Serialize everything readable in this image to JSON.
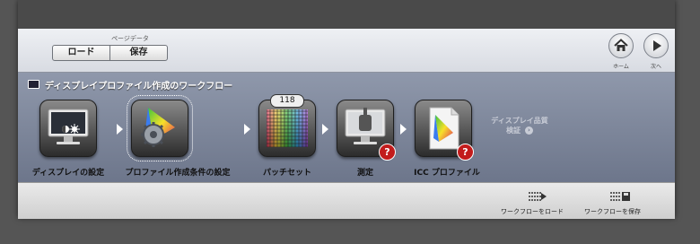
{
  "toolbar": {
    "page_data_label": "ページデータ",
    "load_label": "ロード",
    "save_label": "保存",
    "home_label": "ホーム",
    "next_label": "次へ"
  },
  "workflow": {
    "title": "ディスプレイプロファイル作成のワークフロー",
    "steps": [
      {
        "label": "ディスプレイの設定",
        "icon": "display-settings-icon"
      },
      {
        "label": "プロファイル作成条件の設定",
        "icon": "profile-conditions-icon"
      },
      {
        "label": "パッチセット",
        "icon": "patch-set-icon",
        "badge": "118"
      },
      {
        "label": "測定",
        "icon": "measurement-icon"
      },
      {
        "label": "ICC プロファイル",
        "icon": "icc-profile-icon"
      }
    ],
    "verify_label_1": "ディスプレイ品質",
    "verify_label_2": "検証"
  },
  "footer": {
    "load_workflow": "ワークフローをロード",
    "save_workflow": "ワークフローを保存"
  }
}
